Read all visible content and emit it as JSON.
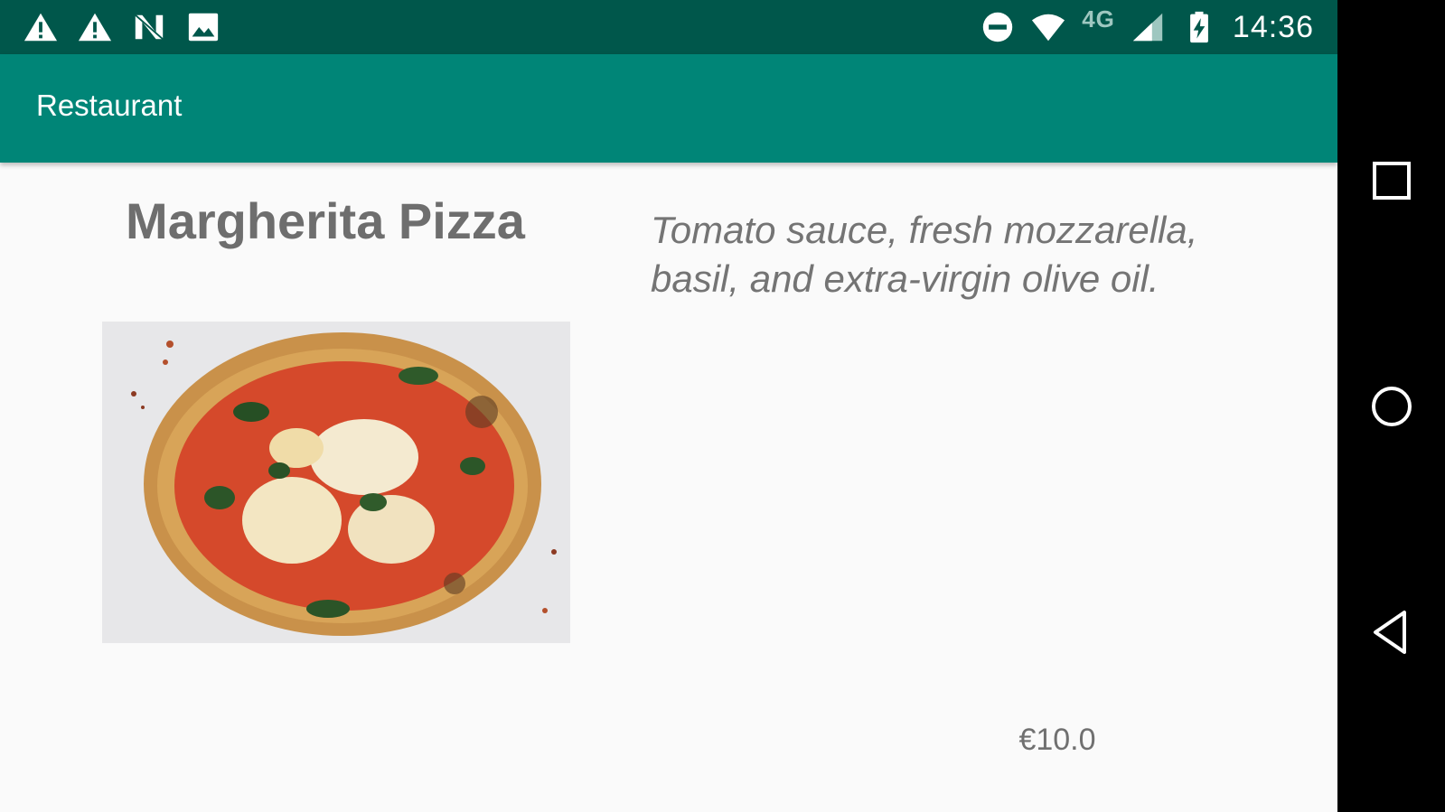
{
  "status_bar": {
    "time": "14:36",
    "network_type": "4G",
    "left_icons": [
      "warning-icon",
      "warning-icon",
      "n-notification-icon",
      "image-icon"
    ],
    "right_icons": [
      "do-not-disturb-icon",
      "wifi-icon",
      "cell-signal-icon",
      "battery-charging-icon"
    ]
  },
  "app_bar": {
    "title": "Restaurant"
  },
  "dish": {
    "name": "Margherita Pizza",
    "description": "Tomato sauce, fresh mozzarella, basil, and extra-virgin olive oil.",
    "price": "€10.0"
  },
  "nav_bar": {
    "buttons": [
      "recents-icon",
      "home-icon",
      "back-icon"
    ]
  },
  "colors": {
    "status_bar": "#00574b",
    "app_bar": "#008577",
    "background": "#fafafa",
    "text": "#6e6e6e"
  }
}
